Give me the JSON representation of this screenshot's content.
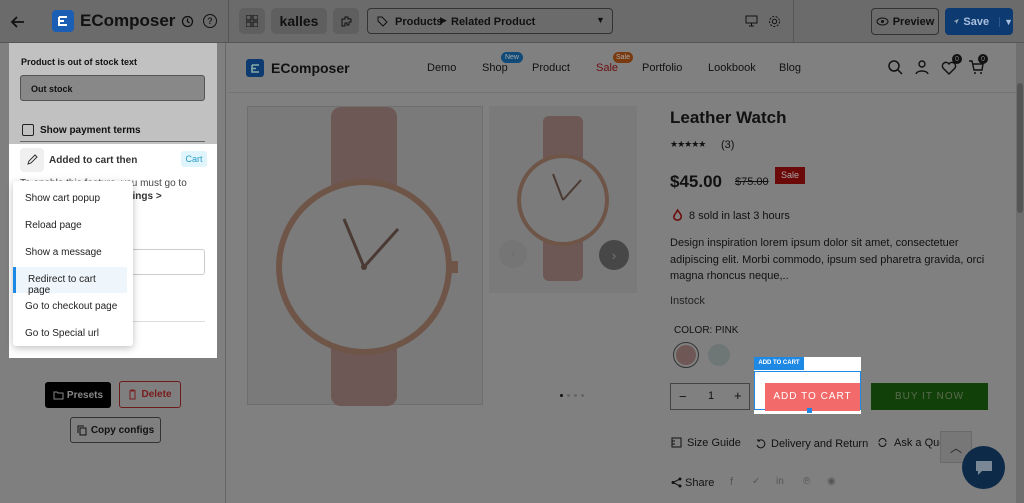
{
  "topbar": {
    "brand": "EComposer",
    "kalles": "kalles",
    "breadcrumb_a": "Products",
    "breadcrumb_b": "Related Product",
    "preview": "Preview",
    "save": "Save"
  },
  "sidebar": {
    "oos_label": "Product is out of stock text",
    "oos_value": "Out stock",
    "payment_terms": "Show payment terms",
    "added_label": "Added to cart then",
    "added_badge": "Cart",
    "note_a": "To enable this feature, you must go to",
    "note_b": "> Settings >",
    "menu": [
      "Show cart popup",
      "Reload page",
      "Show a message",
      "Redirect to cart page",
      "Go to checkout page",
      "Go to Special url"
    ],
    "presets": "Presets",
    "delete": "Delete",
    "copy": "Copy configs"
  },
  "store": {
    "brand": "EComposer",
    "nav": [
      "Demo",
      "Shop",
      "Product",
      "Sale",
      "Portfolio",
      "Lookbook",
      "Blog"
    ],
    "shop_badge": "New",
    "sale_badge": "Sale",
    "wishlist_count": "0",
    "cart_count": "0"
  },
  "product": {
    "title": "Leather Watch",
    "reviews": "(3)",
    "price": "$45.00",
    "compare_price": "$75.00",
    "sale_tag": "Sale",
    "sold": "8 sold in last 3 hours",
    "desc": "Design inspiration lorem ipsum dolor sit amet, consectetuer adipiscing elit. Morbi commodo, ipsum sed pharetra gravida, orci magna rhoncus neque,..",
    "stock": "Instock",
    "color_label": "COLOR: PINK",
    "qty": "1",
    "atc_tag": "ADD TO CART",
    "atc": "ADD TO CART",
    "buy": "BUY IT NOW",
    "size_guide": "Size Guide",
    "delivery": "Delivery and Return",
    "ask": "Ask a Que",
    "share": "Share"
  },
  "colors": {
    "accent": "#1e88e5",
    "buy": "#2e6b14",
    "atc": "#f26a6a",
    "sale": "#d32f2f"
  }
}
